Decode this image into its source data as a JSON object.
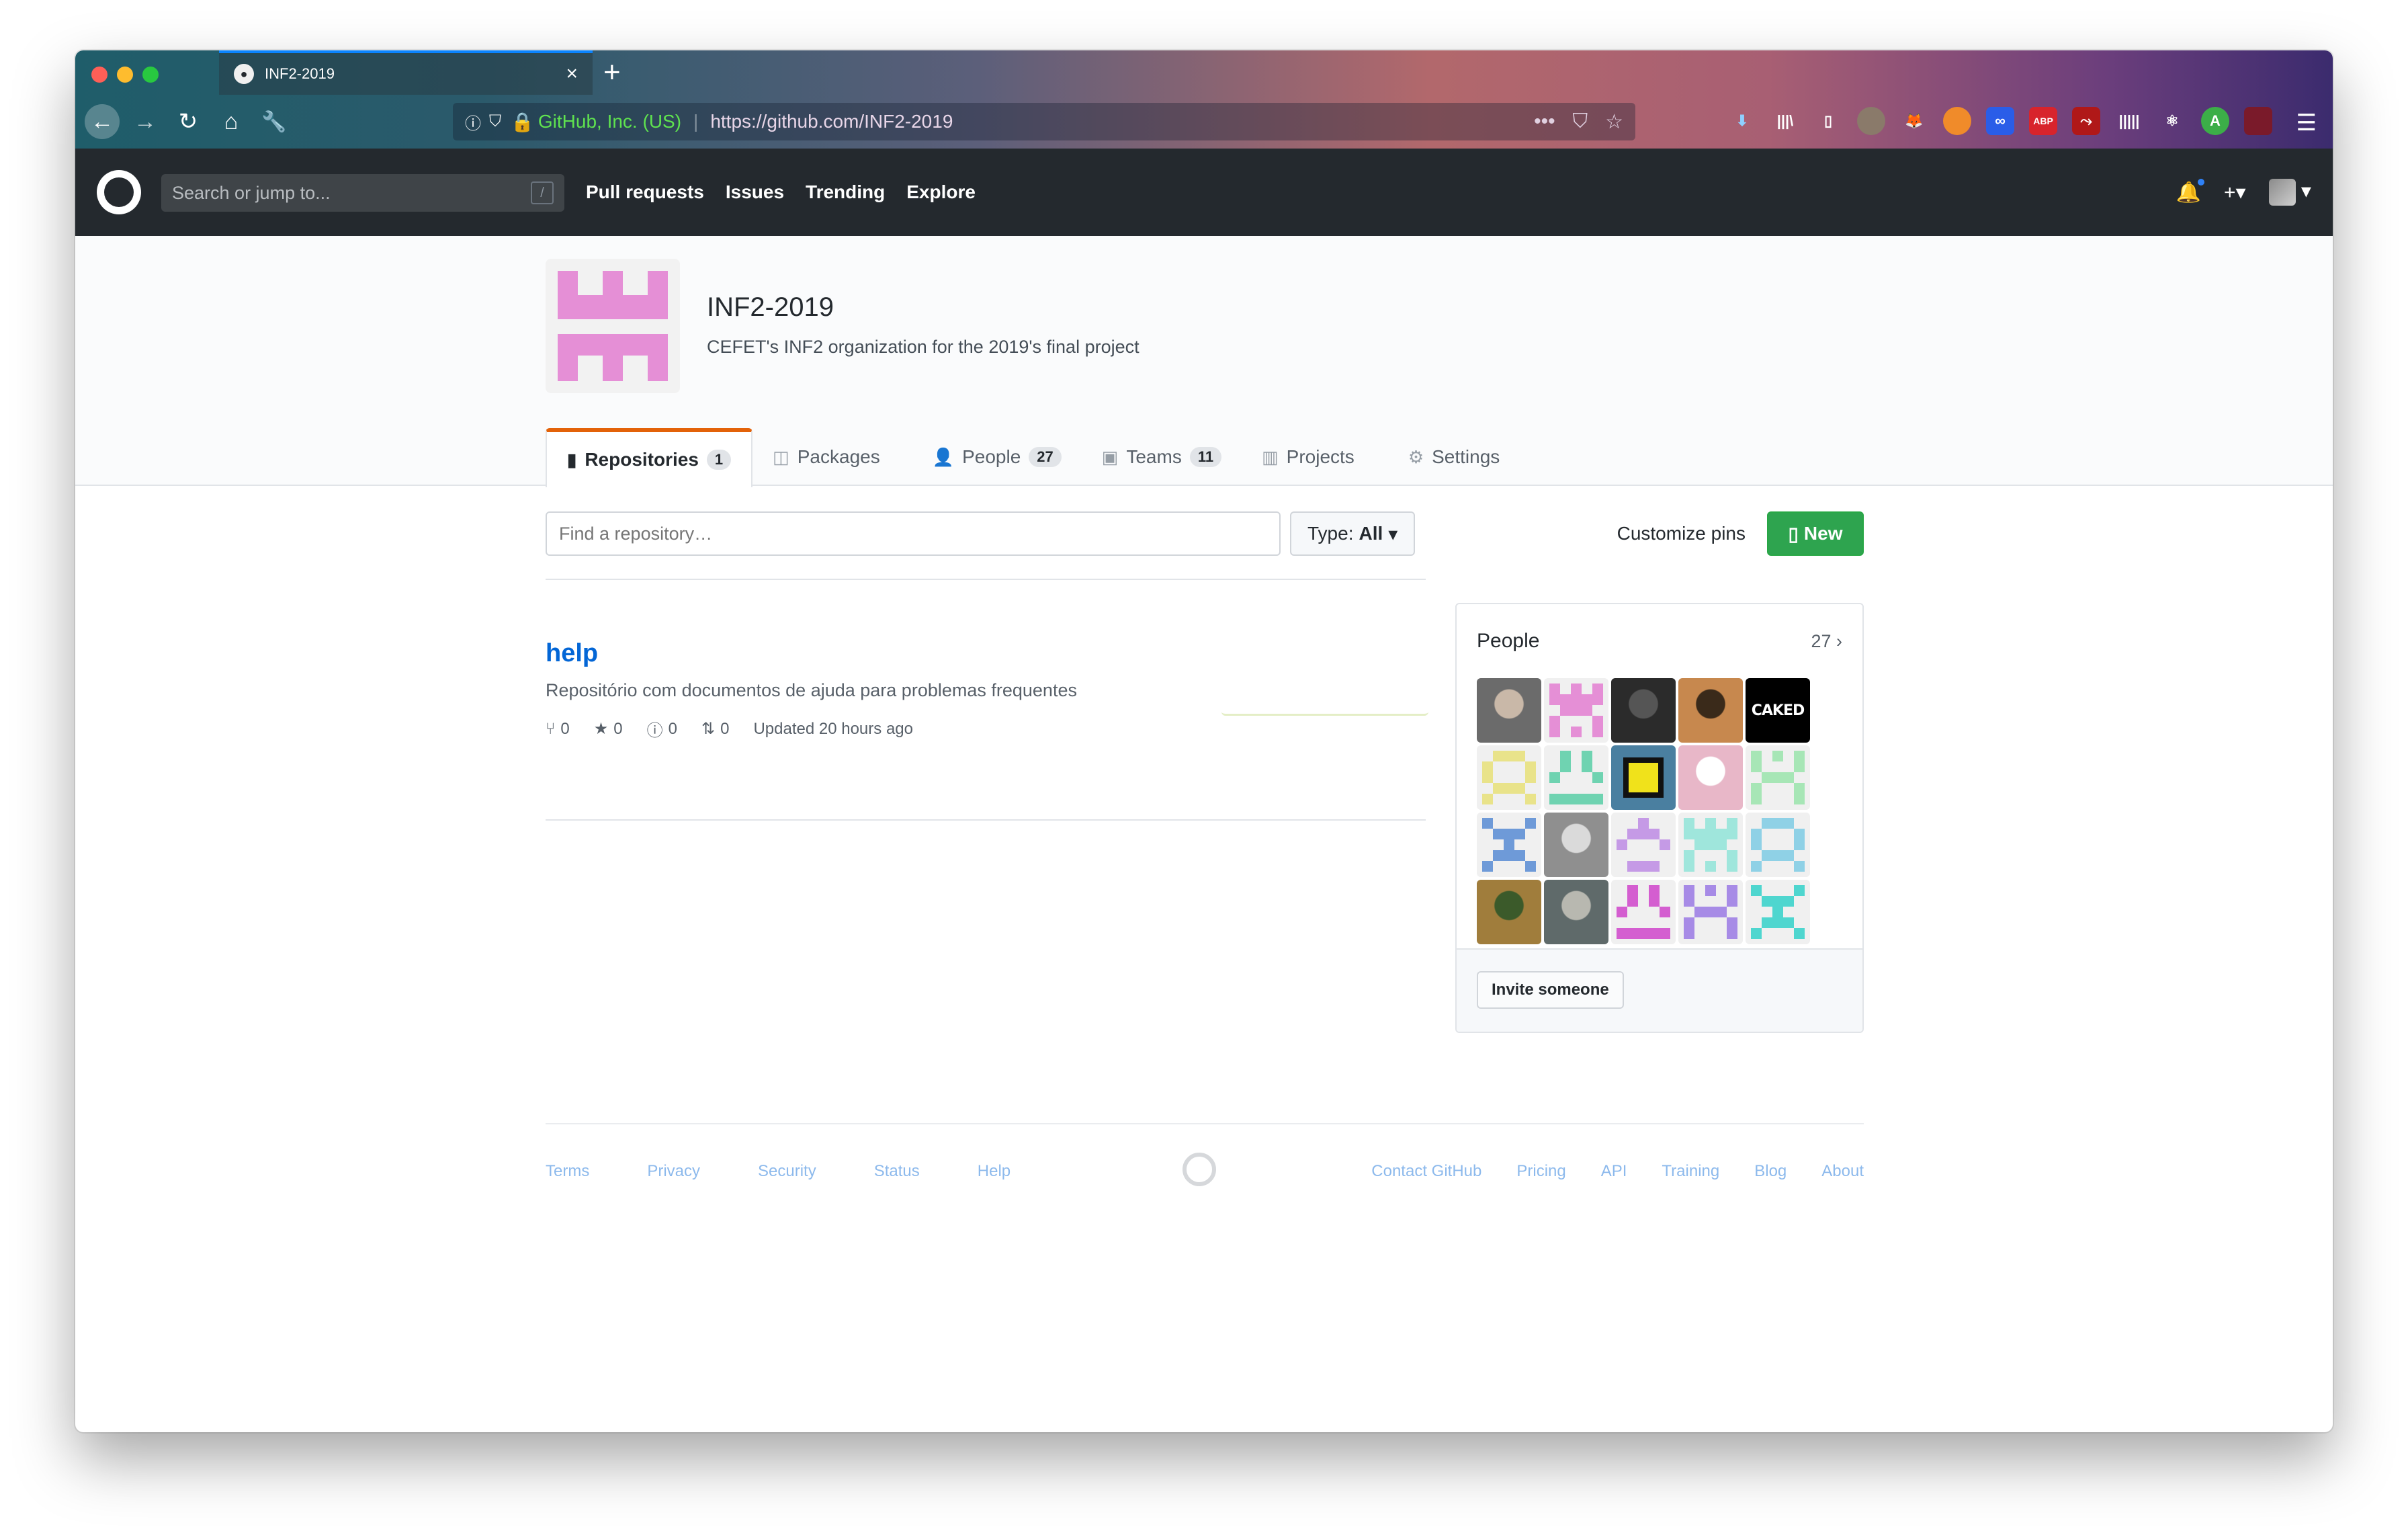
{
  "browser": {
    "tab_title": "INF2-2019",
    "tab_favicon": "github-icon",
    "newtab_label": "+",
    "security_label": "GitHub, Inc. (US)",
    "url": "https://github.com/INF2-2019",
    "url_actions": [
      "•••",
      "pocket-icon",
      "star-icon"
    ],
    "extensions": [
      "download-icon",
      "library-icon",
      "sidebar-icon",
      "avatar-ext",
      "gitlab-ext",
      "orange-ext",
      "blue-ext",
      "ABP",
      "pdf-ext",
      "bars-ext",
      "react-ext",
      "A",
      "red-ext"
    ],
    "menu_icon": "hamburger-icon"
  },
  "gh_header": {
    "search_placeholder": "Search or jump to...",
    "search_shortcut": "/",
    "nav": [
      "Pull requests",
      "Issues",
      "Trending",
      "Explore"
    ],
    "plus_label": "+▾",
    "colors": {
      "header_bg": "#24292e"
    }
  },
  "org": {
    "name": "INF2-2019",
    "description": "CEFET's INF2 organization for the 2019's final project",
    "avatar_color": "#e58fd6"
  },
  "tabs": [
    {
      "label": "Repositories",
      "count": "1",
      "icon": "repo-icon",
      "active": true
    },
    {
      "label": "Packages",
      "count": "",
      "icon": "package-icon",
      "active": false
    },
    {
      "label": "People",
      "count": "27",
      "icon": "person-icon",
      "active": false
    },
    {
      "label": "Teams",
      "count": "11",
      "icon": "jersey-icon",
      "active": false
    },
    {
      "label": "Projects",
      "count": "",
      "icon": "project-icon",
      "active": false
    },
    {
      "label": "Settings",
      "count": "",
      "icon": "gear-icon",
      "active": false
    }
  ],
  "controls": {
    "find_placeholder": "Find a repository…",
    "type_label": "Type:",
    "type_value": "All",
    "customize_label": "Customize pins",
    "new_label": "New"
  },
  "repo": {
    "name": "help",
    "description": "Repositório com documentos de ajuda para problemas frequentes",
    "forks": "0",
    "stars": "0",
    "issues": "0",
    "pulls": "0",
    "updated": "Updated 20 hours ago"
  },
  "people": {
    "title": "People",
    "count": "27",
    "invite_label": "Invite someone",
    "avatars": [
      {
        "kind": "photo",
        "colors": [
          "#6b6b6b",
          "#c9b8a8"
        ]
      },
      {
        "kind": "identicon",
        "color": "#e58fd6"
      },
      {
        "kind": "photo",
        "colors": [
          "#2b2b2b",
          "#555555"
        ]
      },
      {
        "kind": "photo",
        "colors": [
          "#c7884e",
          "#3a2a1a"
        ]
      },
      {
        "kind": "text",
        "text": "CAKED"
      },
      {
        "kind": "identicon",
        "color": "#e9e38a"
      },
      {
        "kind": "identicon",
        "color": "#6fd3b1"
      },
      {
        "kind": "logo",
        "colors": [
          "#f0e21b",
          "#111111"
        ]
      },
      {
        "kind": "drawing",
        "colors": [
          "#e8b7c8",
          "#ffffff"
        ]
      },
      {
        "kind": "identicon",
        "color": "#a7e6b6"
      },
      {
        "kind": "identicon",
        "color": "#6e9ad8"
      },
      {
        "kind": "photo",
        "colors": [
          "#8f8f8f",
          "#dadada"
        ]
      },
      {
        "kind": "identicon",
        "color": "#c59ae6"
      },
      {
        "kind": "identicon",
        "color": "#9fe6dc"
      },
      {
        "kind": "identicon",
        "color": "#8fd1e6"
      },
      {
        "kind": "photo",
        "colors": [
          "#a07d3c",
          "#3b5a2a"
        ]
      },
      {
        "kind": "photo",
        "colors": [
          "#5f6a6a",
          "#b8b8b0"
        ]
      },
      {
        "kind": "identicon",
        "color": "#d45ed0"
      },
      {
        "kind": "identicon",
        "color": "#a78be6"
      },
      {
        "kind": "identicon",
        "color": "#4fd6cf"
      }
    ]
  },
  "footer": {
    "left": [
      "Terms",
      "Privacy",
      "Security",
      "Status",
      "Help"
    ],
    "right": [
      "Contact GitHub",
      "Pricing",
      "API",
      "Training",
      "Blog",
      "About"
    ]
  }
}
